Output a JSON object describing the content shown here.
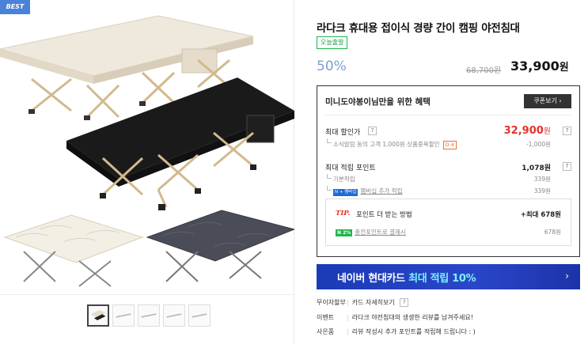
{
  "gallery": {
    "badge": "BEST",
    "main_image_alt": "folding camping cots",
    "thumbnails": [
      {
        "name": "thumb-1",
        "active": true
      },
      {
        "name": "thumb-2",
        "active": false
      },
      {
        "name": "thumb-3",
        "active": false
      },
      {
        "name": "thumb-4",
        "active": false
      },
      {
        "name": "thumb-5",
        "active": false
      }
    ]
  },
  "product": {
    "title": "라다크 휴대용 접이식 경량 간이 캠핑 야전침대",
    "today_badge": "오늘출발",
    "discount": "50%",
    "original_price": "68,700원",
    "sale_price": "33,900",
    "sale_price_unit": "원"
  },
  "benefits": {
    "title": "미니도야봉이님만을 위한 혜택",
    "coupon_button": "쿠폰보기 ›",
    "max_discount": {
      "label": "최대 할인가",
      "value": "32,900",
      "unit": "원",
      "sub_label": "소식알림 동의 고객 1,000원 상품중복할인",
      "sub_badge": "D-4",
      "sub_value": "-1,000원"
    },
    "max_points": {
      "label": "최대 적립 포인트",
      "value": "1,078원",
      "basic_label": "기본적립",
      "basic_value": "339원",
      "membership_badge_n": "N + 멤버십",
      "membership_label": "멤버십 추가 적립",
      "membership_value": "339원"
    },
    "tip": {
      "label": "TIP.",
      "text": "포인트 더 받는 방법",
      "max": "+최대 678원",
      "sub_badge": "N 2%",
      "sub_label": "충전포인트로 결제시",
      "sub_value": "678원"
    },
    "q_mark": "?"
  },
  "banner": {
    "text_main": "네이버 현대카드 ",
    "text_accent": "최대 적립 10%",
    "arrow": "›"
  },
  "extras": [
    {
      "key": "무이자할부",
      "value": "카드 자세히보기"
    },
    {
      "key": "이벤트",
      "value": "라다크 야전침대의 생생한 리뷰를 남겨주세요!"
    },
    {
      "key": "사은품",
      "value": "리뷰 작성시 추가 포인트를 적립해 드립니다 : )"
    }
  ],
  "colors": {
    "accent_blue": "#7b9fd4",
    "price_red": "#e5332a",
    "naver_green": "#1fb649",
    "banner_blue": "#1a3bb5",
    "badge_blue": "#4a82d8"
  }
}
